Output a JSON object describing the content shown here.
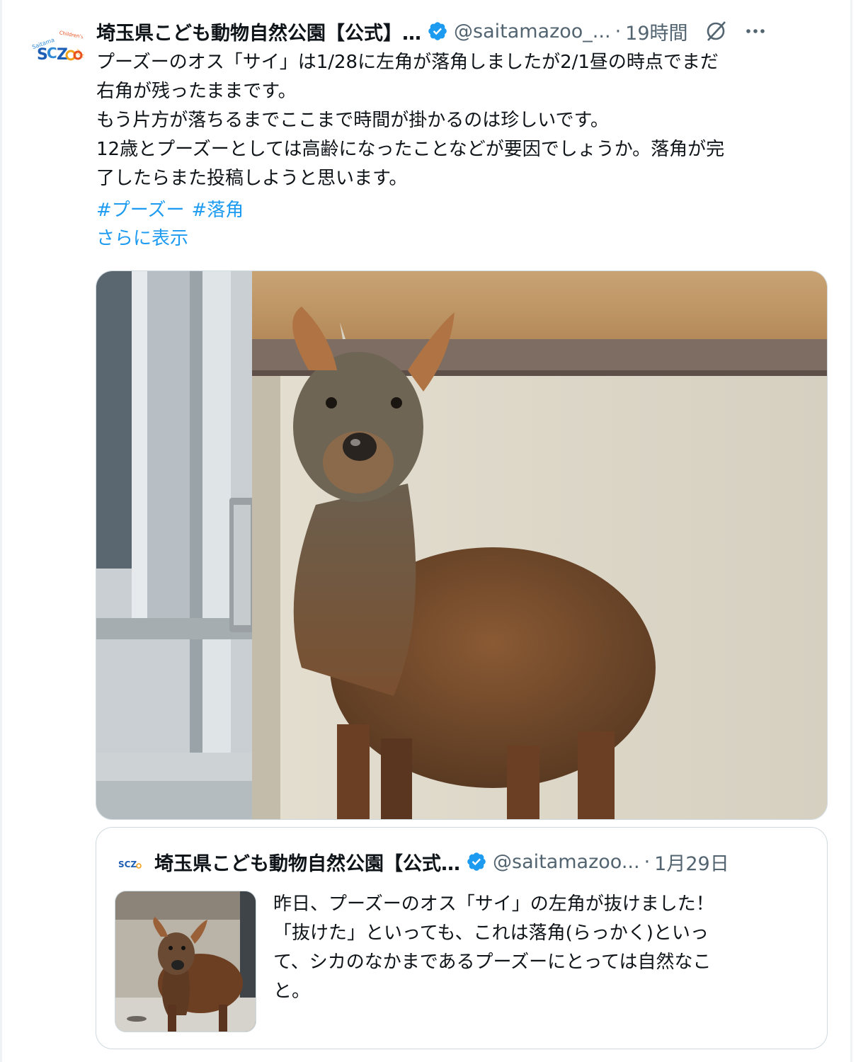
{
  "tweet": {
    "author_name": "埼玉県こども動物自然公園【公式】…",
    "handle": "@saitamazoo_...",
    "separator": "·",
    "time": "19時間",
    "avatar_text": "Saitama Children's Zoo",
    "avatar_logo": "SCZoo",
    "body_lines": [
      "プーズーのオス「サイ」は1/28に左角が落角しましたが2/1昼の時点でまだ",
      "右角が残ったままです。",
      "もう片方が落ちるまでここまで時間が掛かるのは珍しいです。",
      "12歳とプーズーとしては高齢になったことなどが要因でしょうか。落角が完",
      "了したらまた投稿しようと思います。"
    ],
    "hashtags": [
      "#プーズー",
      "#落角"
    ],
    "show_more": "さらに表示"
  },
  "quoted": {
    "author_name": "埼玉県こども動物自然公園【公式…",
    "handle": "@saitamazoo...",
    "separator": "·",
    "time": "1月29日",
    "body_lines": [
      "昨日、プーズーのオス「サイ」の左角が抜けました！",
      "「抜けた」といっても、これは落角(らっかく)といっ",
      "て、シカのなかまであるプーズーにとっては自然なこ",
      "と。"
    ]
  },
  "colors": {
    "link": "#1d9bf0",
    "verified": "#1d9bf0",
    "secondary_text": "#536471",
    "border": "#cfd9de"
  },
  "icons": [
    "verified-badge-icon",
    "grok-icon",
    "more-icon"
  ]
}
